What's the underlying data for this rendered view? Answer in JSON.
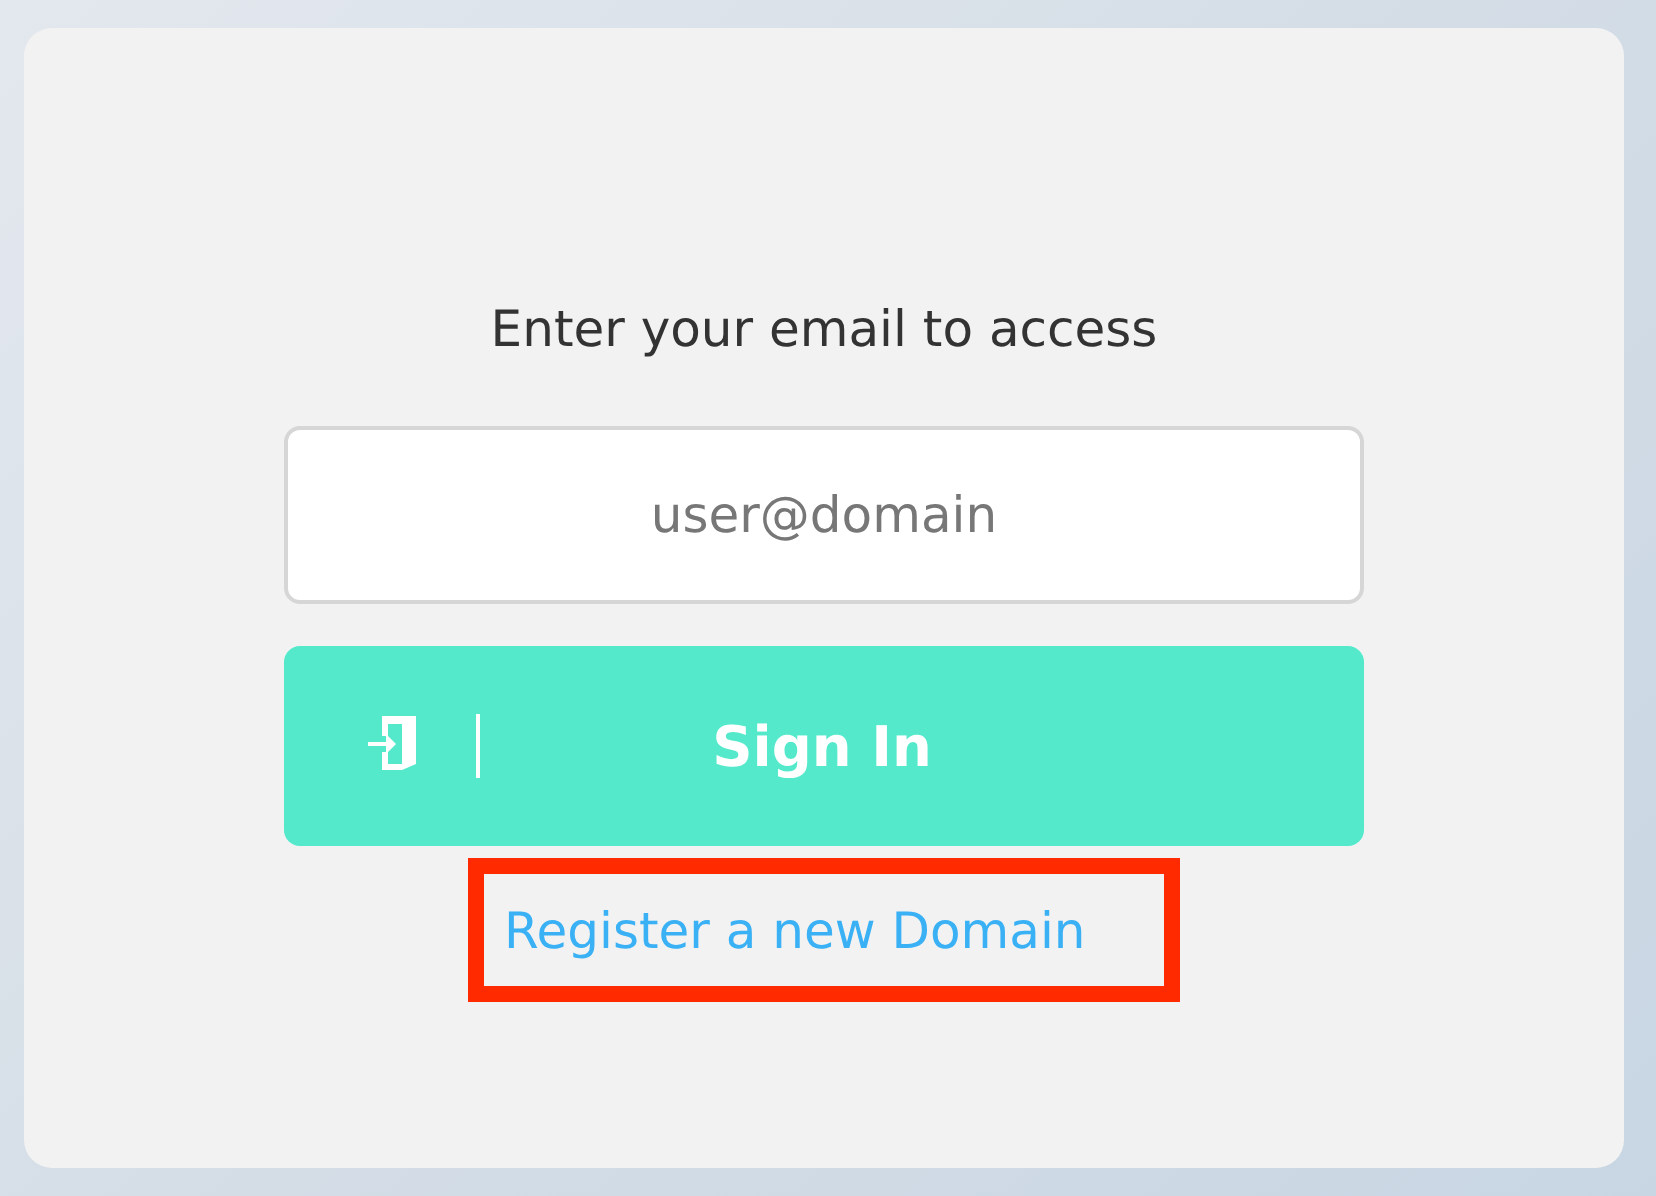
{
  "prompt": "Enter your email to access",
  "email_field": {
    "placeholder": "user@domain"
  },
  "sign_in_button": {
    "label": "Sign In"
  },
  "register_link": {
    "label": "Register a new Domain",
    "highlighted": true
  }
}
